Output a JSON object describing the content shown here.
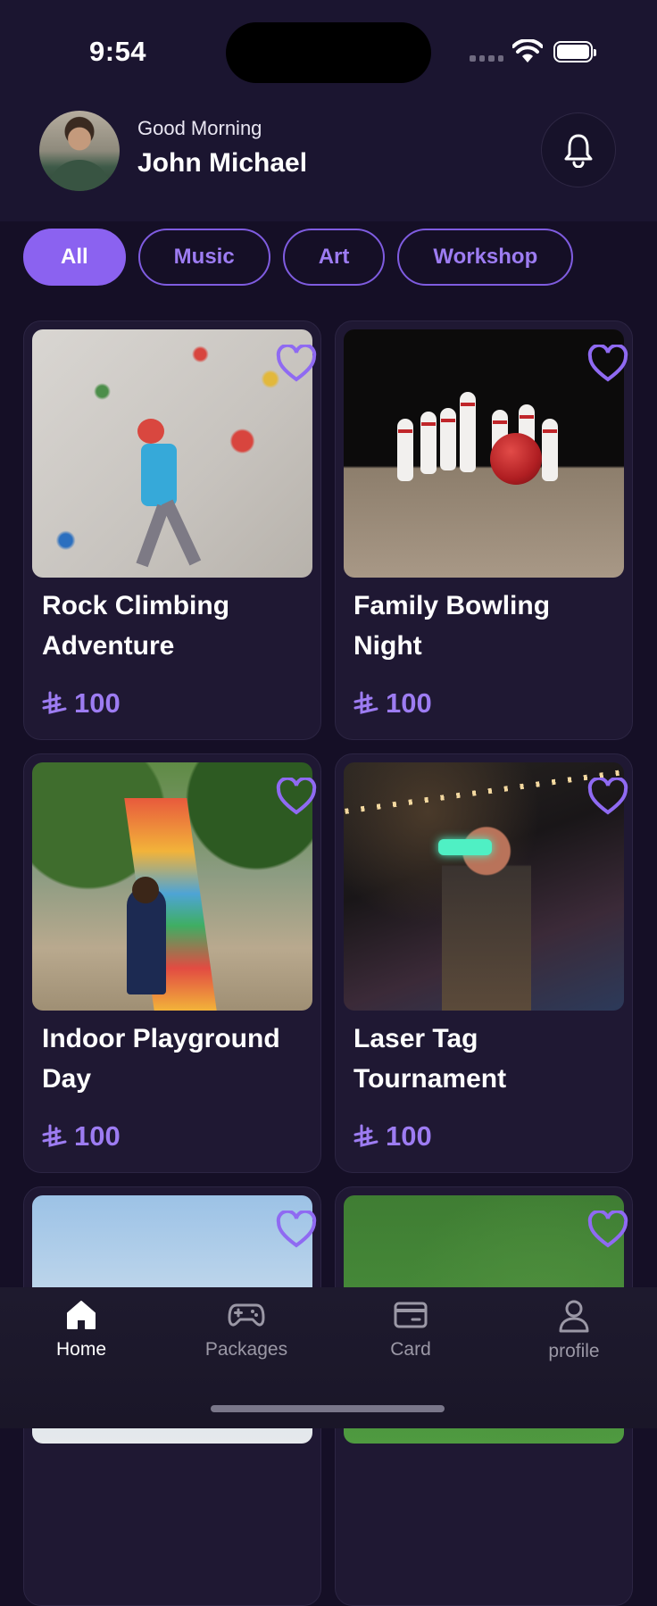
{
  "status_bar": {
    "time": "9:54"
  },
  "header": {
    "greeting": "Good Morning",
    "username": "John Michael"
  },
  "filters": [
    {
      "label": "All",
      "active": true
    },
    {
      "label": "Music",
      "active": false
    },
    {
      "label": "Art",
      "active": false
    },
    {
      "label": "Workshop",
      "active": false
    }
  ],
  "events": [
    {
      "title": "Rock Climbing Adventure",
      "price": "100"
    },
    {
      "title": "Family Bowling Night",
      "price": "100"
    },
    {
      "title": "Indoor Playground Day",
      "price": "100"
    },
    {
      "title": "Laser Tag Tournament",
      "price": "100"
    }
  ],
  "tabs": [
    {
      "label": "Home",
      "icon": "home-icon",
      "active": true
    },
    {
      "label": "Packages",
      "icon": "gamepad-icon",
      "active": false
    },
    {
      "label": "Card",
      "icon": "card-icon",
      "active": false
    },
    {
      "label": "profile",
      "icon": "profile-icon",
      "active": false
    }
  ],
  "colors": {
    "background": "#150f26",
    "accent": "#8b62f0",
    "card": "#1f1833"
  }
}
